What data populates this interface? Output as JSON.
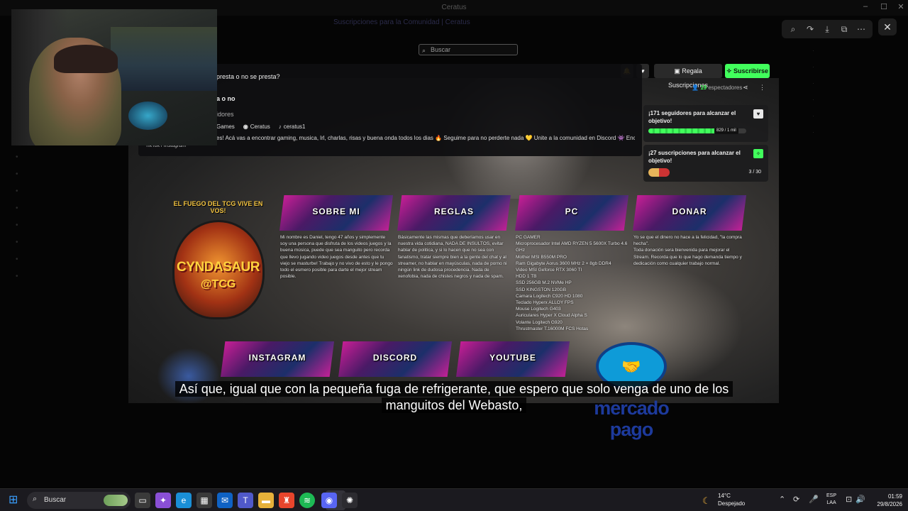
{
  "window": {
    "title": "Ceratus",
    "banner_text": "Suscripciones para la Comunidad | Ceratus"
  },
  "viewer_toolbar": {
    "icons": [
      "zoom-in-icon",
      "share-icon",
      "download-icon",
      "open-external-icon",
      "more-icon"
    ],
    "close_icon": "close-icon"
  },
  "twitch": {
    "search_placeholder": "Buscar",
    "gift_label": "Regala Suscripciones",
    "subscribe_label": "Suscribirse",
    "viewers_count": "19",
    "viewers_label": "espectadores",
    "accent_color": "#41ff5c"
  },
  "about": {
    "question": "presta o no se presta?",
    "question2": "a o no",
    "followers": "idores",
    "links": [
      "Games",
      "Ceratus",
      "ceratus1"
    ],
    "bio": "es! Acá vas a encontrar gaming, musica, lrl, charlas, risas y buena onda todos los dias 🔥 Seguime para no perderte nada 💛 Unite a la comunidad en Discord 👾 Encontrame también en",
    "tiktok": "TikTok / Instagram"
  },
  "goals": [
    {
      "title": "¡171 seguidores para alcanzar el objetivo!",
      "progress": 0.87,
      "badge": "829 / 1 mil"
    },
    {
      "title": "¡27 suscripciones para alcanzar el objetivo!",
      "count": "3 / 30"
    }
  ],
  "panels": [
    {
      "title": "SOBRE MI",
      "text": "Mi nombre es Daniel, tengo 47 años y simplemente soy una persona que disfruta de los videos juegos y la buena música, puede que sea manguito pero recorda que llevo jugando video juegos desde antes que tu viejo se masturbe! Trabajo y no vivo de esto y le pongo todo el esmero posible para darte el mejor stream posible."
    },
    {
      "title": "REGLAS",
      "text": "Básicamente las mismas que deberíamos usar en nuestra vida cotidiana, NADA DE INSULTOS, evitar hablar de politica, y si lo hacen que no sea con fanatismo, tratar siempre bien a la gente del chat y al streamer, no hablar en mayúsculas, nada de porno ni ningún link de dudosa procedencia. Nada de xenofobia, nada de chistes negros y nada de spam."
    },
    {
      "title": "PC",
      "text": "PC GAMER\nMicroprocesador Intel AMD RYZEN 5 5600X Turbo 4.6 GHz\nMother MSI B550M PRO\nRam Gigabyte Aorus 3600 MHz 2 × 8gb DDR4\nVideo MSI Geforce RTX 3060 TI\nHDD 1 TB\nSSD 256GB M.2 NVMe HP\nSSD KINGSTON 120GB\nCamara Logitech C920 HD 1080\nTeclado Hyperx ALLOY FPS\nMouse Logitech G403\nAuriculares Hyper X Cloud Alpha S\nVolante Logitech G920\nThrustmaster T.16000M FCS Hotas"
    },
    {
      "title": "DONAR",
      "text": "Yo se que el dinero no hace a la felicidad, \"la compra hecha\".\nToda donación sera bienvenida para mejorar el Stream. Recorda que lo que hago demanda tiempo y dedicación como cualquier trabajo normal."
    }
  ],
  "social_panels": [
    "INSTAGRAM",
    "DISCORD",
    "YOUTUBE"
  ],
  "logo": {
    "top_text": "EL FUEGO DEL TCG VIVE EN VOS!",
    "name": "CYNDASAUR",
    "sub": "@TCG"
  },
  "mercado_pago": {
    "line1": "mercado",
    "line2": "pago"
  },
  "subtitles": {
    "line1": "Así que, igual que con la pequeña fuga de refrigerante, que espero que solo venga de uno de los",
    "line2": "manguitos del Webasto,"
  },
  "taskbar": {
    "search_label": "Buscar",
    "weather_temp": "14°C",
    "weather_desc": "Despejado",
    "lang1": "ESP",
    "lang2": "LAA",
    "time": "01:59",
    "date": "29/8/2026"
  }
}
